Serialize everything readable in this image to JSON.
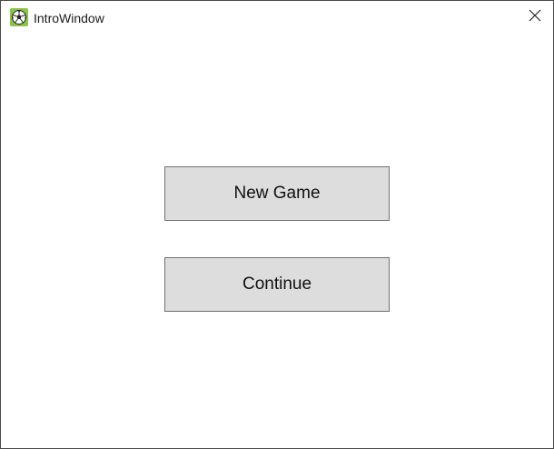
{
  "window": {
    "title": "IntroWindow",
    "app_icon": "soccer-ball-icon",
    "close_icon": "close-icon",
    "accent_color": "#8bc34a"
  },
  "main": {
    "new_game_label": "New Game",
    "continue_label": "Continue"
  }
}
